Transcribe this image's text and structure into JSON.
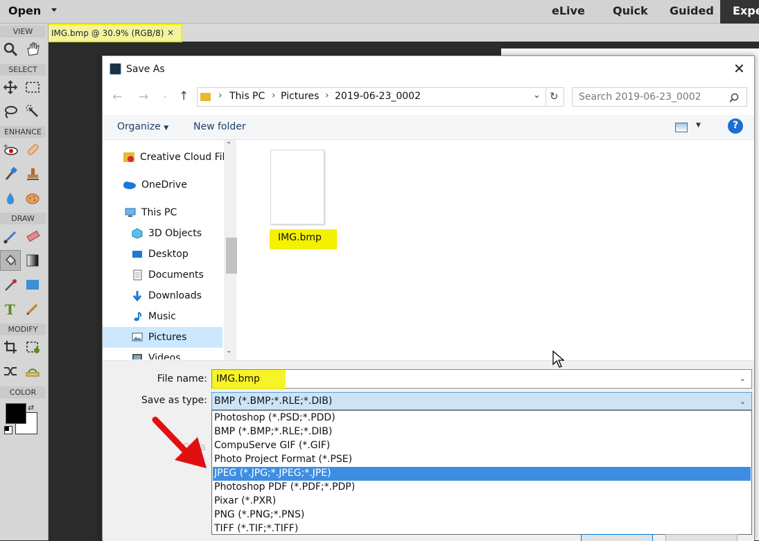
{
  "topbar": {
    "open_label": "Open",
    "modes": [
      "eLive",
      "Quick",
      "Guided",
      "Expe"
    ]
  },
  "toolbox": {
    "sections": [
      "VIEW",
      "SELECT",
      "ENHANCE",
      "DRAW",
      "MODIFY",
      "COLOR"
    ],
    "colors": {
      "foreground": "#000000",
      "background": "#ffffff"
    }
  },
  "document_tab": {
    "title": "IMG.bmp @ 30.9% (RGB/8)",
    "close": "×"
  },
  "dialog": {
    "title": "Save As",
    "close": "✕",
    "breadcrumb": [
      "This PC",
      "Pictures",
      "2019-06-23_0002"
    ],
    "search_placeholder": "Search 2019-06-23_0002",
    "organize_label": "Organize",
    "new_folder_label": "New folder",
    "help_label": "?",
    "nav_items": [
      {
        "label": "Creative Cloud File",
        "icon": "creative-cloud-icon"
      },
      {
        "label": "OneDrive",
        "icon": "onedrive-icon"
      },
      {
        "label": "This PC",
        "icon": "pc-icon"
      },
      {
        "label": "3D Objects",
        "icon": "3d-objects-icon"
      },
      {
        "label": "Desktop",
        "icon": "desktop-icon"
      },
      {
        "label": "Documents",
        "icon": "documents-icon"
      },
      {
        "label": "Downloads",
        "icon": "downloads-icon"
      },
      {
        "label": "Music",
        "icon": "music-icon"
      },
      {
        "label": "Pictures",
        "icon": "pictures-icon"
      },
      {
        "label": "Videos",
        "icon": "videos-icon"
      }
    ],
    "file": {
      "name": "IMG.bmp"
    },
    "file_name_label": "File name:",
    "file_name_value": "IMG.bmp",
    "save_type_label": "Save as type:",
    "save_type_value": "BMP (*.BMP;*.RLE;*.DIB)",
    "type_options": [
      "Photoshop (*.PSD;*.PDD)",
      "BMP (*.BMP;*.RLE;*.DIB)",
      "CompuServe GIF (*.GIF)",
      "Photo Project Format (*.PSE)",
      "JPEG (*.JPG;*.JPEG;*.JPE)",
      "Photoshop PDF (*.PDF;*.PDP)",
      "Pixar (*.PXR)",
      "PNG (*.PNG;*.PNS)",
      "TIFF (*.TIF;*.TIFF)"
    ],
    "selected_option": "JPEG (*.JPG;*.JPEG;*.JPE)",
    "background_fragment": "Orga"
  }
}
